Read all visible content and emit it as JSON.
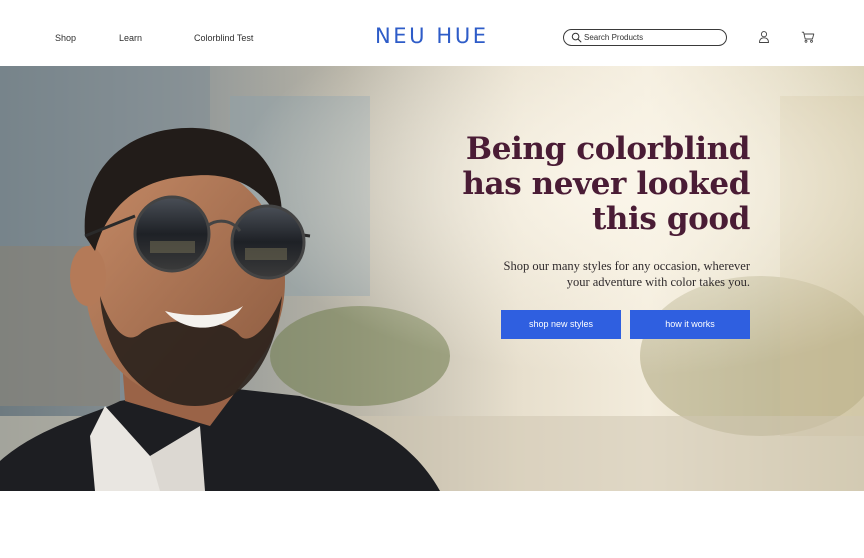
{
  "header": {
    "nav": {
      "shop": "Shop",
      "learn": "Learn",
      "colorblind_test": "Colorblind Test"
    },
    "logo": "NEU HUE",
    "search": {
      "placeholder": "Search Products",
      "value": ""
    },
    "icons": {
      "account": "user-icon",
      "cart": "cart-icon",
      "search": "search-icon"
    }
  },
  "hero": {
    "headline": [
      "Being colorblind",
      "has never looked",
      "this good"
    ],
    "subtext_lines": [
      "Shop our many styles for any occasion, wherever",
      "your adventure with color takes you."
    ],
    "buttons": {
      "primary": "shop new styles",
      "secondary": "how it works"
    }
  },
  "colors": {
    "accent": "#2f5fe0",
    "logo": "#2e5cc8",
    "headline": "#4a1c35"
  }
}
